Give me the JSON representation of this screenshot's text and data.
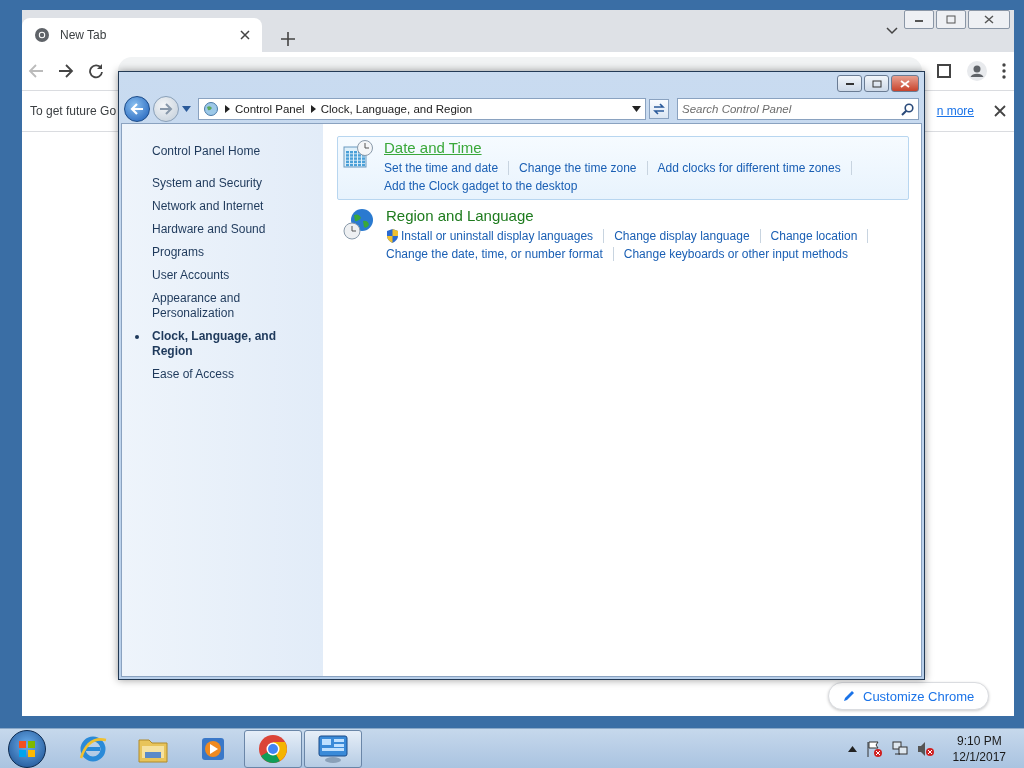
{
  "browser": {
    "tab": {
      "title": "New Tab"
    },
    "infobar": {
      "text": "To get future Go",
      "link": "n more"
    },
    "customize_button": "Customize Chrome"
  },
  "control_panel": {
    "breadcrumb": [
      "Control Panel",
      "Clock, Language, and Region"
    ],
    "search": {
      "placeholder": "Search Control Panel"
    },
    "sidebar": {
      "home": "Control Panel Home",
      "items": [
        {
          "label": "System and Security",
          "selected": false
        },
        {
          "label": "Network and Internet",
          "selected": false
        },
        {
          "label": "Hardware and Sound",
          "selected": false
        },
        {
          "label": "Programs",
          "selected": false
        },
        {
          "label": "User Accounts",
          "selected": false
        },
        {
          "label": "Appearance and Personalization",
          "selected": false
        },
        {
          "label": "Clock, Language, and Region",
          "selected": true
        },
        {
          "label": "Ease of Access",
          "selected": false
        }
      ]
    },
    "categories": [
      {
        "kind": "clock",
        "title": "Date and Time",
        "highlighted": true,
        "rows": [
          [
            {
              "text": "Set the time and date",
              "shield": false
            },
            {
              "text": "Change the time zone",
              "shield": false
            },
            {
              "text": "Add clocks for different time zones",
              "shield": false
            }
          ],
          [
            {
              "text": "Add the Clock gadget to the desktop",
              "shield": false
            }
          ]
        ]
      },
      {
        "kind": "globe",
        "title": "Region and Language",
        "highlighted": false,
        "rows": [
          [
            {
              "text": "Install or uninstall display languages",
              "shield": true
            },
            {
              "text": "Change display language",
              "shield": false
            },
            {
              "text": "Change location",
              "shield": false
            }
          ],
          [
            {
              "text": "Change the date, time, or number format",
              "shield": false
            },
            {
              "text": "Change keyboards or other input methods",
              "shield": false
            }
          ]
        ]
      }
    ]
  },
  "taskbar": {
    "apps": [
      {
        "kind": "ie",
        "active": false
      },
      {
        "kind": "folder",
        "active": false
      },
      {
        "kind": "media",
        "active": false
      },
      {
        "kind": "chrome",
        "active": true
      },
      {
        "kind": "control",
        "active": true
      }
    ],
    "clock": {
      "time": "9:10 PM",
      "date": "12/1/2017"
    }
  }
}
